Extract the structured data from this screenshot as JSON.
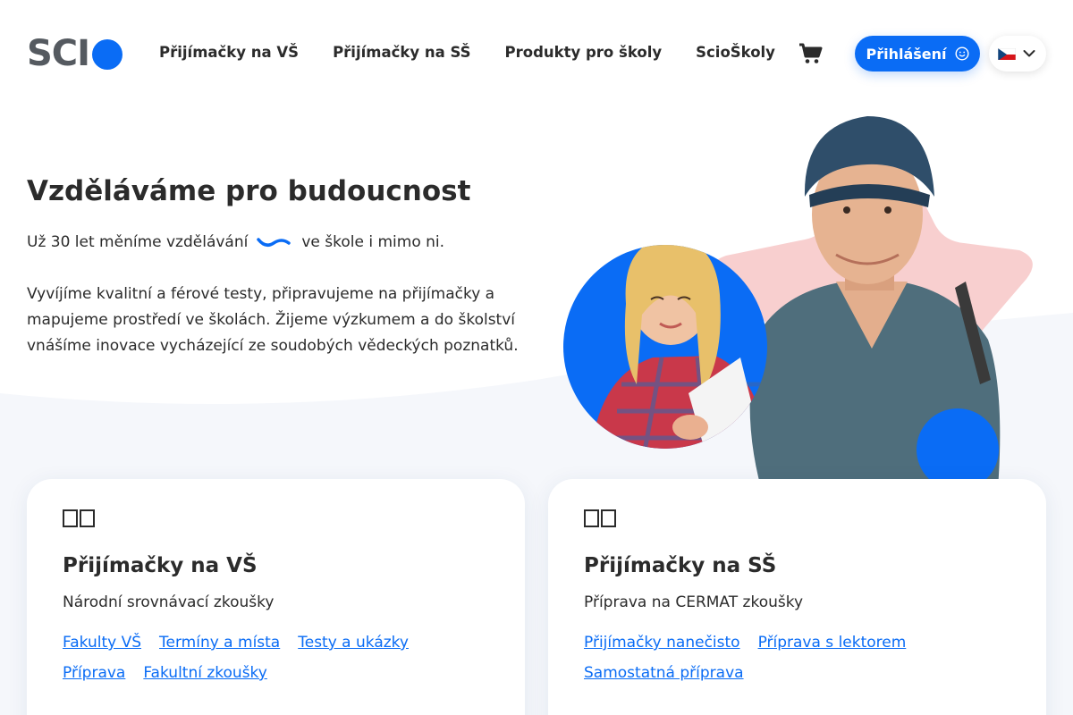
{
  "brand": {
    "logo_text": "SCI",
    "accent": "#0a6cf5",
    "star_color": "#f8cfcf"
  },
  "nav": {
    "items": [
      {
        "label": "Přijímačky na VŠ"
      },
      {
        "label": "Přijímačky na SŠ"
      },
      {
        "label": "Produkty pro školy"
      },
      {
        "label": "ScioŠkoly"
      }
    ]
  },
  "header": {
    "cart_icon": "cart-icon",
    "login_label": "Přihlášení",
    "login_icon": "smiley-icon",
    "language": {
      "flag": "czech-flag-icon",
      "chevron": "chevron-down-icon"
    }
  },
  "hero": {
    "title": "Vzděláváme pro budoucnost",
    "subtitle_before": "Už 30 let měníme vzdělávání",
    "subtitle_after": "ve škole i mimo ni.",
    "body": "Vyvíjíme kvalitní a férové testy, připravujeme na přijímačky a mapujeme prostředí ve školách. Žijeme výzkumem a do školství vnášíme inovace vycházející ze soudobých vědeckých poznatků."
  },
  "cards": [
    {
      "icon": "book-icon",
      "title": "Přijímačky na VŠ",
      "subtitle": "Národní srovnávací zkoušky",
      "links": [
        "Fakulty VŠ",
        "Termíny a místa",
        "Testy a ukázky",
        "Příprava",
        "Fakultní zkoušky"
      ]
    },
    {
      "icon": "book-icon",
      "title": "Přijímačky na SŠ",
      "subtitle": "Příprava na CERMAT zkoušky",
      "links": [
        "Přijímačky nanečisto",
        "Příprava s lektorem",
        "Samostatná příprava"
      ]
    }
  ]
}
